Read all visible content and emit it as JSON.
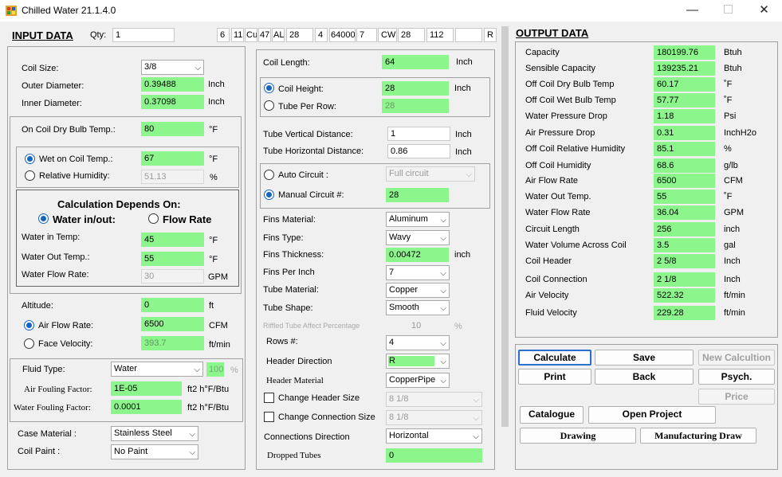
{
  "window": {
    "title": "Chilled Water  21.1.4.0"
  },
  "header": {
    "input_title": "INPUT DATA",
    "qty_label": "Qty:",
    "qty_value": "1",
    "code": [
      "6",
      "11",
      "Cu",
      "47",
      "AL",
      "28",
      "4",
      "64000",
      "7",
      "CW",
      "28",
      "112",
      "",
      "R"
    ]
  },
  "left": {
    "coil_size_label": "Coil Size:",
    "coil_size": "3/8",
    "od_label": "Outer Diameter:",
    "od": "0.39488",
    "od_unit": "Inch",
    "id_label": "Inner Diameter:",
    "id": "0.37098",
    "id_unit": "Inch",
    "db_label": "On Coil Dry Bulb Temp.:",
    "db": "80",
    "db_unit": "°F",
    "wet_label": "Wet on Coil Temp.:",
    "wet": "67",
    "wet_unit": "°F",
    "rh_label": "Relative Humidity:",
    "rh": "51.13",
    "rh_unit": "%",
    "calc_title": "Calculation Depends On:",
    "opt_water": "Water in/out:",
    "opt_flow": "Flow Rate",
    "win_label": "Water in Temp:",
    "win": "45",
    "win_unit": "°F",
    "wout_label": "Water Out Temp.:",
    "wout": "55",
    "wout_unit": "°F",
    "wfr_label": "Water Flow Rate:",
    "wfr": "30",
    "wfr_unit": "GPM",
    "alt_label": "Altitude:",
    "alt": "0",
    "alt_unit": "ft",
    "afr_label": "Air Flow Rate:",
    "afr": "6500",
    "afr_unit": "CFM",
    "fv_label": "Face Velocity:",
    "fv": "393.7",
    "fv_unit": "ft/min",
    "fluid_label": "Fluid Type:",
    "fluid": "Water",
    "fluid_pct": "100",
    "fluid_pct_unit": "%",
    "aff_label": "Air Fouling Factor:",
    "aff": "1E-05",
    "aff_unit": "ft2 h°F/Btu",
    "wff_label": "Water Fouling Factor:",
    "wff": "0.0001",
    "wff_unit": "ft2 h°F/Btu",
    "case_label": "Case Material :",
    "case": "Stainless Steel",
    "paint_label": "Coil Paint :",
    "paint": "No Paint"
  },
  "mid": {
    "len_label": "Coil Length:",
    "len": "64",
    "len_unit": "Inch",
    "height_label": "Coil Height:",
    "height": "28",
    "height_unit": "Inch",
    "tpr_label": "Tube Per Row:",
    "tpr": "28",
    "tvd_label": "Tube Vertical Distance:",
    "tvd": "1",
    "tvd_unit": "Inch",
    "thd_label": "Tube Horizontal Distance:",
    "thd": "0.86",
    "thd_unit": "Inch",
    "auto_label": "Auto Circuit :",
    "auto": "Full circuit",
    "manual_label": "Manual Circuit #:",
    "manual": "28",
    "fmat_label": "Fins Material:",
    "fmat": "Aluminum",
    "ftype_label": "Fins Type:",
    "ftype": "Wavy",
    "fthk_label": "Fins Thickness:",
    "fthk": "0.00472",
    "fthk_unit": "inch",
    "fpi_label": "Fins Per Inch",
    "fpi": "7",
    "tmat_label": "Tube Material:",
    "tmat": "Copper",
    "tshape_label": "Tube Shape:",
    "tshape": "Smooth",
    "rifled_label": "Riffled Tube Affect Percentage",
    "rifled": "10",
    "rifled_unit": "%",
    "rows_label": "Rows #:",
    "rows": "4",
    "hdir_label": "Header Direction",
    "hdir": "R",
    "hmat_label": "Header Material",
    "hmat": "CopperPipe",
    "chs_label": "Change Header Size",
    "chs": "8 1/8",
    "ccs_label": "Change Connection Size",
    "ccs": "8 1/8",
    "cdir_label": "Connections Direction",
    "cdir": "Horizontal",
    "drop_label": "Dropped Tubes",
    "drop": "0"
  },
  "output": {
    "title": "OUTPUT DATA",
    "rows": [
      {
        "label": "Capacity",
        "value": "180199.76",
        "unit": "Btuh"
      },
      {
        "label": "Sensible Capacity",
        "value": "139235.21",
        "unit": "Btuh"
      },
      {
        "label": "Off Coil Dry Bulb Temp",
        "value": "60.17",
        "unit": "˚F"
      },
      {
        "label": "Off Coil Wet Bulb Temp",
        "value": "57.77",
        "unit": "˚F"
      },
      {
        "label": "Water Pressure Drop",
        "value": "1.18",
        "unit": "Psi"
      },
      {
        "label": "Air Pressure Drop",
        "value": "0.31",
        "unit": "InchH2o"
      },
      {
        "label": "Off Coil Relative Humidity",
        "value": "85.1",
        "unit": "%"
      },
      {
        "label": "Off Coil Humidity",
        "value": "68.6",
        "unit": "g/lb"
      },
      {
        "label": "Air Flow Rate",
        "value": "6500",
        "unit": "CFM"
      },
      {
        "label": "Water Out Temp.",
        "value": "55",
        "unit": "˚F"
      },
      {
        "label": "Water Flow Rate",
        "value": "36.04",
        "unit": "GPM"
      },
      {
        "label": "Circuit Length",
        "value": "256",
        "unit": "inch"
      },
      {
        "label": "Water Volume Across Coil",
        "value": "3.5",
        "unit": "gal"
      },
      {
        "label": "Coil Header",
        "value": "2 5/8",
        "unit": "Inch"
      },
      {
        "label": "Coil Connection",
        "value": "2 1/8",
        "unit": "Inch"
      },
      {
        "label": "Air Velocity",
        "value": "522.32",
        "unit": "ft/min"
      },
      {
        "label": "Fluid Velocity",
        "value": "229.28",
        "unit": "ft/min"
      }
    ]
  },
  "buttons": {
    "calculate": "Calculate",
    "save": "Save",
    "new_calc": "New Calcultion",
    "print": "Print",
    "back": "Back",
    "psych": "Psych.",
    "price": "Price",
    "catalogue": "Catalogue",
    "open_project": "Open Project",
    "drawing": "Drawing",
    "manufacturing": "Manufacturing Draw"
  },
  "colors": {
    "highlight": "#8cf58c",
    "accent": "#1565c0"
  }
}
